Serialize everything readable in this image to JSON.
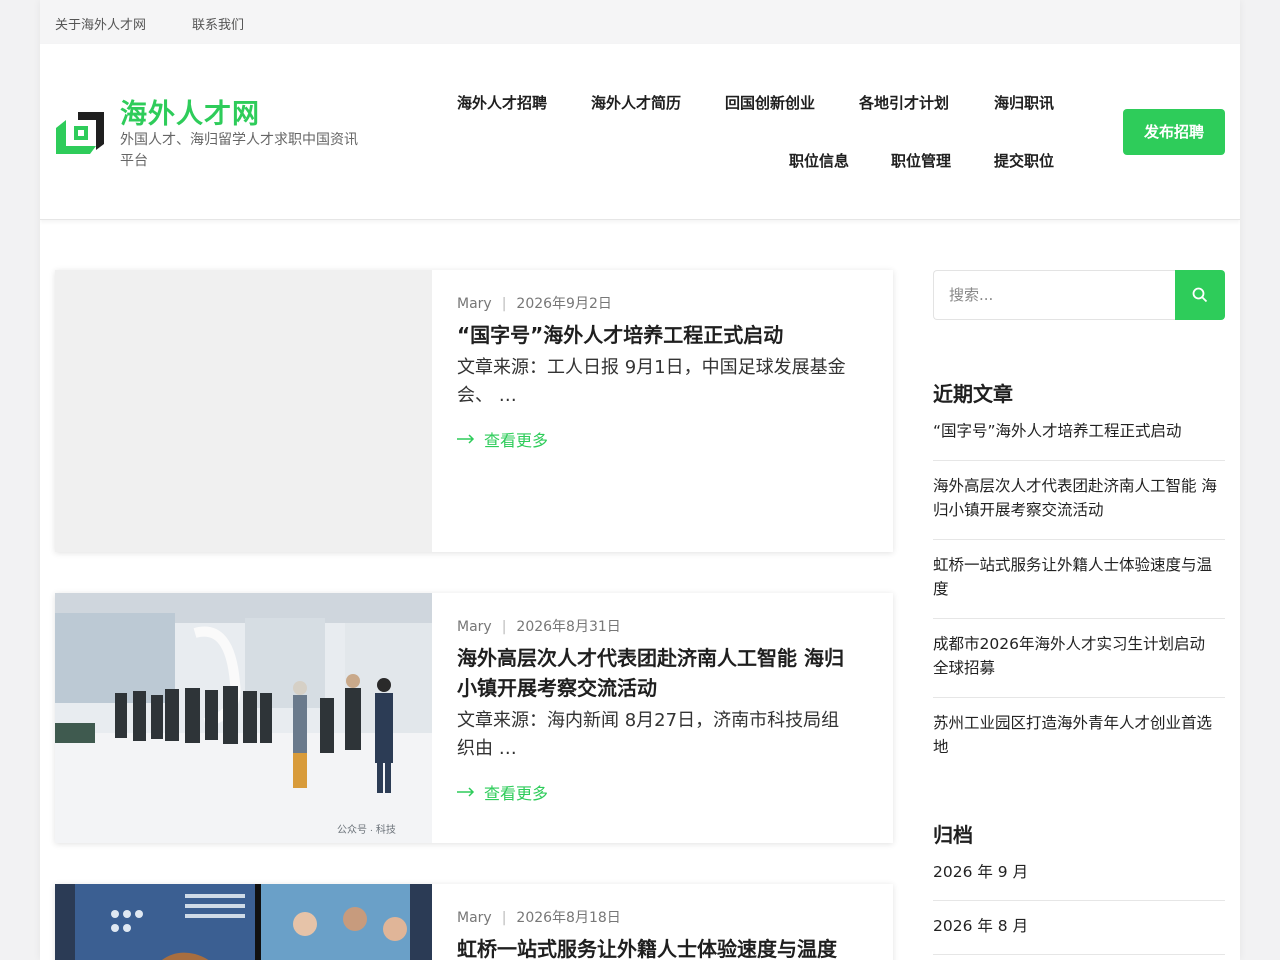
{
  "topbar": {
    "links": [
      "关于海外人才网",
      "联系我们"
    ]
  },
  "site": {
    "title": "海外人才网",
    "description": "外国人才、海归留学人才求职中国资讯平台",
    "brand_color": "#2ecc5a"
  },
  "nav": {
    "row1": [
      "海外人才招聘",
      "海外人才简历",
      "回国创新创业",
      "各地引才计划",
      "海归职讯"
    ],
    "row2": [
      "职位信息",
      "职位管理",
      "提交职位"
    ],
    "publish_button": "发布招聘"
  },
  "posts": [
    {
      "author": "Mary",
      "date": "2026年9月2日",
      "title": "“国字号”海外人才培养工程正式启动",
      "excerpt": "文章来源：工人日报 9月1日，中国足球发展基金会、 …",
      "more": "查看更多",
      "thumb": "empty"
    },
    {
      "author": "Mary",
      "date": "2026年8月31日",
      "title": "海外高层次人才代表团赴济南人工智能 海归小镇开展考察交流活动",
      "excerpt": "文章来源：海内新闻 8月27日，济南市科技局组织由 …",
      "more": "查看更多",
      "thumb": "photo-group-visit",
      "watermark": "公众号 · 科技"
    },
    {
      "author": "Mary",
      "date": "2026年8月18日",
      "title": "虹桥一站式服务让外籍人士体验速度与温度",
      "thumb": "photo-service-center"
    }
  ],
  "sidebar": {
    "search_placeholder": "搜索...",
    "recent_title": "近期文章",
    "recent": [
      "“国字号”海外人才培养工程正式启动",
      "海外高层次人才代表团赴济南人工智能 海归小镇开展考察交流活动",
      "虹桥一站式服务让外籍人士体验速度与温度",
      "成都市2026年海外人才实习生计划启动 全球招募",
      "苏州工业园区打造海外青年人才创业首选地"
    ],
    "archive_title": "归档",
    "archives": [
      "2026 年 9 月",
      "2026 年 8 月"
    ]
  }
}
